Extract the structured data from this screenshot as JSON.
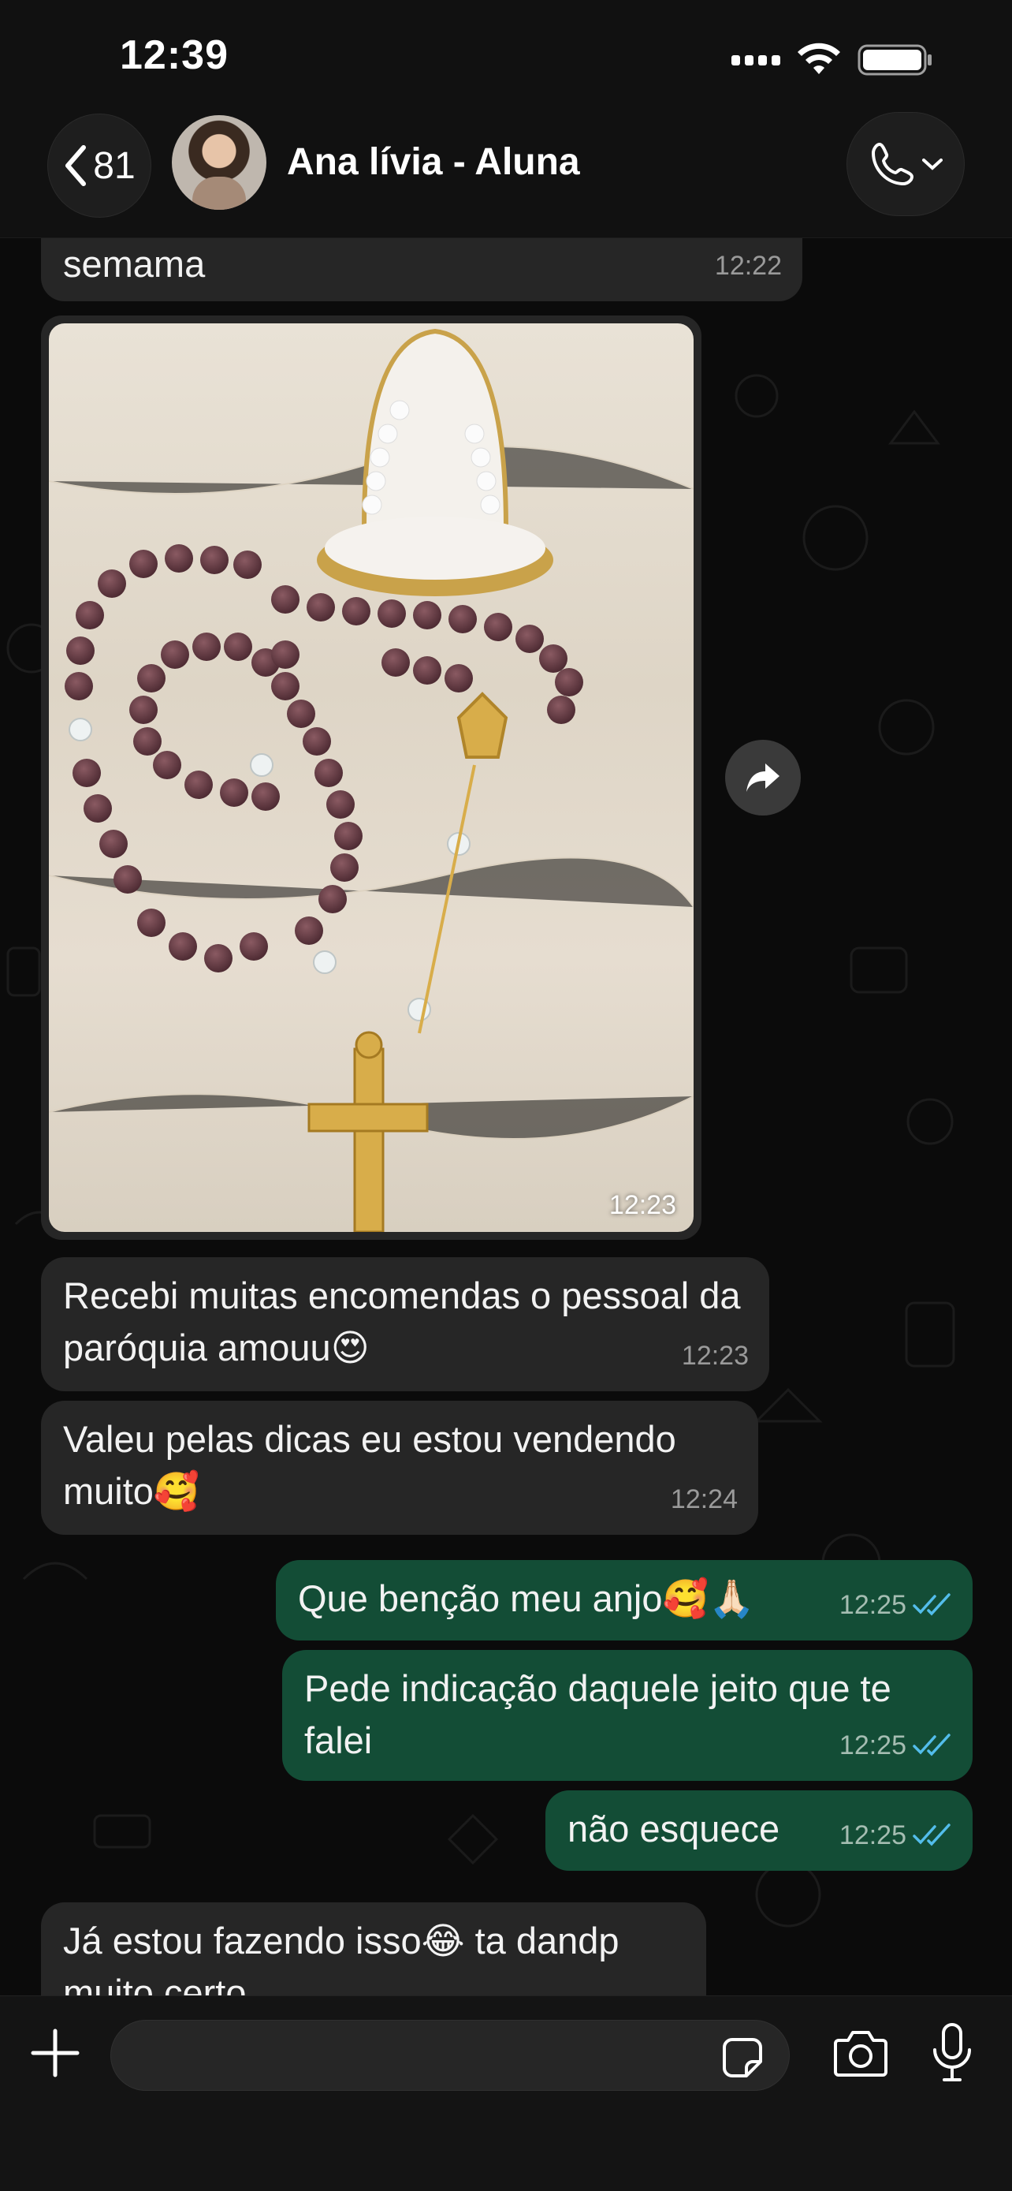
{
  "status_bar": {
    "time": "12:39"
  },
  "header": {
    "back_count": "81",
    "contact_name": "Ana lívia - Aluna"
  },
  "messages": [
    {
      "dir": "in",
      "text": "semama",
      "time": "12:22"
    },
    {
      "dir": "in",
      "type": "image",
      "time": "12:23"
    },
    {
      "dir": "in",
      "text": "Recebi muitas encomendas o pessoal da paróquia amouu😍",
      "time": "12:23"
    },
    {
      "dir": "in",
      "text": "Valeu pelas dicas eu estou vendendo muito🥰",
      "time": "12:24"
    },
    {
      "dir": "out",
      "text": "Que benção meu anjo🥰🙏🏻",
      "time": "12:25"
    },
    {
      "dir": "out",
      "text": "Pede indicação daquele jeito que te falei",
      "time": "12:25"
    },
    {
      "dir": "out",
      "text": "não esquece",
      "time": "12:25"
    },
    {
      "dir": "in",
      "text": "Já estou fazendo isso😂 ta dandp muito certo"
    }
  ],
  "input": {
    "placeholder": ""
  },
  "colors": {
    "incoming": "#262626",
    "outgoing": "#134d36",
    "ticks": "#53bdeb",
    "background": "#0b0b0b"
  },
  "icons": [
    "chevron-left-icon",
    "phone-icon",
    "chevron-down-icon",
    "forward-icon",
    "plus-icon",
    "sticker-icon",
    "camera-icon",
    "mic-icon",
    "double-check-icon"
  ]
}
